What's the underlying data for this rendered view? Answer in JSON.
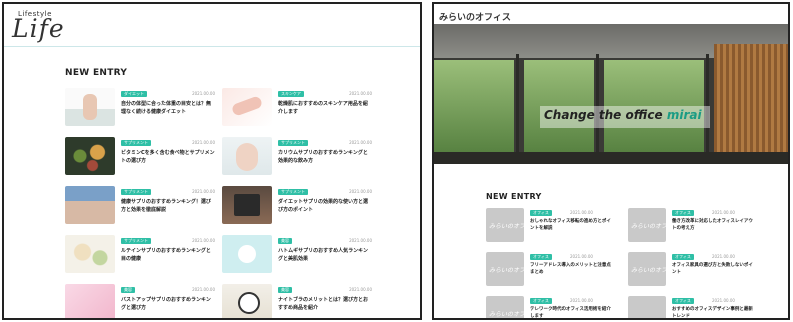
{
  "left": {
    "logo_small": "Lifestyle",
    "logo_big": "Life",
    "section_title": "NEW ENTRY",
    "cards": [
      {
        "tag": "ダイエット",
        "date": "2021.00.00",
        "title": "自分の体型に合った体重の目安とは？無理なく続ける健康ダイエット",
        "art": "art-feet"
      },
      {
        "tag": "スキンケア",
        "date": "2021.00.00",
        "title": "乾燥肌におすすめのスキンケア用品を紹介します",
        "art": "art-hand"
      },
      {
        "tag": "サプリメント",
        "date": "2021.00.00",
        "title": "ビタミンCを多く含む食べ物とサプリメントの選び方",
        "art": "art-food"
      },
      {
        "tag": "サプリメント",
        "date": "2021.00.00",
        "title": "カリウムサプリのおすすめランキングと効果的な飲み方",
        "art": "art-face"
      },
      {
        "tag": "サプリメント",
        "date": "2021.00.00",
        "title": "健康サプリのおすすめランキング！選び方と効果を徹底解説",
        "art": "art-person"
      },
      {
        "tag": "サプリメント",
        "date": "2021.00.00",
        "title": "ダイエットサプリの効果的な使い方と選び方のポイント",
        "art": "art-tablet"
      },
      {
        "tag": "サプリメント",
        "date": "2021.00.00",
        "title": "ルテインサプリのおすすめランキングと目の健康",
        "art": "art-herb"
      },
      {
        "tag": "美容",
        "date": "2021.00.00",
        "title": "ハトムギサプリのおすすめ人気ランキングと美肌効果",
        "art": "art-cup"
      },
      {
        "tag": "美容",
        "date": "2021.00.00",
        "title": "バストアップサプリのおすすめランキングと選び方",
        "art": "art-pink"
      },
      {
        "tag": "美容",
        "date": "2021.00.00",
        "title": "ナイトブラのメリットとは？選び方とおすすめ商品を紹介",
        "art": "art-clock"
      }
    ]
  },
  "right": {
    "brand": "みらいのオフィス",
    "hero": {
      "title_main": "Change the office ",
      "title_accent": "mirai"
    },
    "section_title": "NEW ENTRY",
    "cards": [
      {
        "tag": "オフィス",
        "date": "2021.00.00",
        "title": "おしゃれなオフィス移転の進め方とポイントを解説",
        "thumb_label": "みらいのオフィス"
      },
      {
        "tag": "オフィス",
        "date": "2021.00.00",
        "title": "働き方改革に対応したオフィスレイアウトの考え方",
        "thumb_label": "みらいのオフィス"
      },
      {
        "tag": "オフィス",
        "date": "2021.00.00",
        "title": "フリーアドレス導入のメリットと注意点まとめ",
        "thumb_label": "みらいのオフィス"
      },
      {
        "tag": "オフィス",
        "date": "2021.00.00",
        "title": "オフィス家具の選び方と失敗しないポイント",
        "thumb_label": "みらいのオフィス"
      },
      {
        "tag": "オフィス",
        "date": "2021.00.00",
        "title": "テレワーク時代のオフィス活用術を紹介します",
        "thumb_label": "みらいのオフィス"
      },
      {
        "tag": "オフィス",
        "date": "2021.00.00",
        "title": "おすすめのオフィスデザイン事例と最新トレンド",
        "thumb_label": ""
      }
    ]
  },
  "colors": {
    "tag": "#2fbfa6",
    "accent": "#1a9c84",
    "divider": "#cde7e9"
  }
}
